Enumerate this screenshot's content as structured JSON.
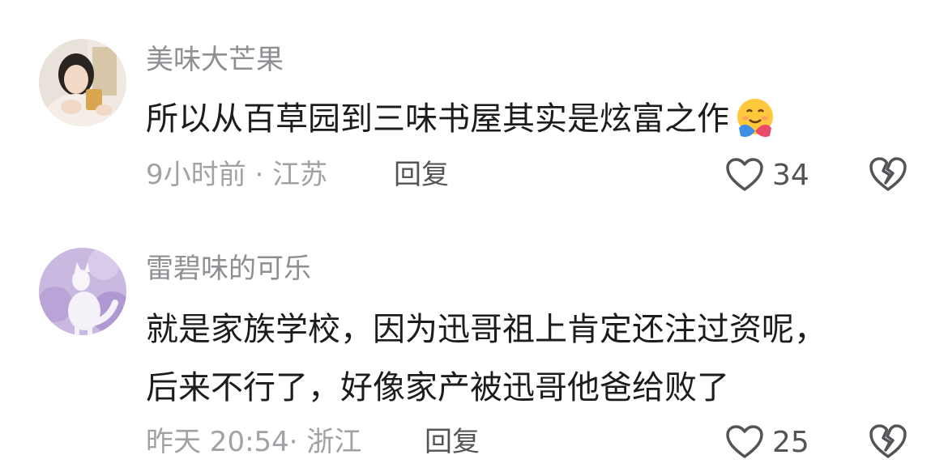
{
  "comments": [
    {
      "username": "美味大芒果",
      "text_lines": [
        "所以从百草园到三味书屋其实是炫富之作"
      ],
      "emoji": "hugging-face",
      "time": "9小时前",
      "separator": "·",
      "location": "江苏",
      "reply_label": "回复",
      "likes": "34"
    },
    {
      "username": "雷碧味的可乐",
      "text_lines": [
        "就是家族学校，因为迅哥祖上肯定还注过资呢，",
        "后来不行了，好像家产被迅哥他爸给败了"
      ],
      "time": "昨天 20:54",
      "separator": "·",
      "location": "浙江",
      "reply_label": "回复",
      "likes": "25"
    }
  ],
  "colors": {
    "text": "#1c1c1e",
    "secondary": "#8e8e93",
    "icon": "#545458"
  }
}
